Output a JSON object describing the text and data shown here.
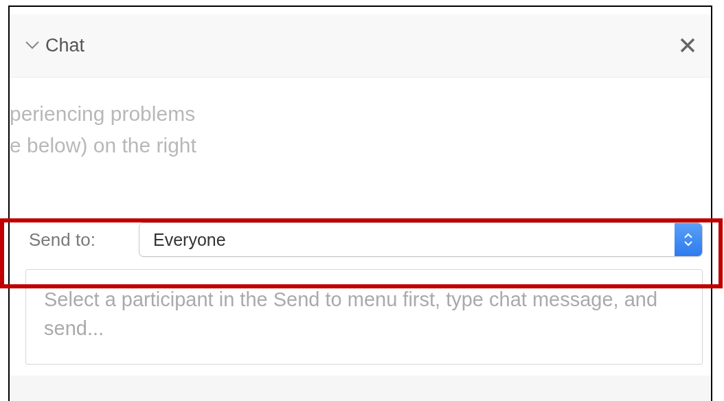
{
  "panel": {
    "title": "Chat",
    "expanded": true
  },
  "background_lines": [
    "periencing problems",
    "e below) on the right"
  ],
  "send_to": {
    "label": "Send to:",
    "value": "Everyone"
  },
  "message": {
    "placeholder": "Select a participant in the Send to menu first, type chat message, and send..."
  }
}
